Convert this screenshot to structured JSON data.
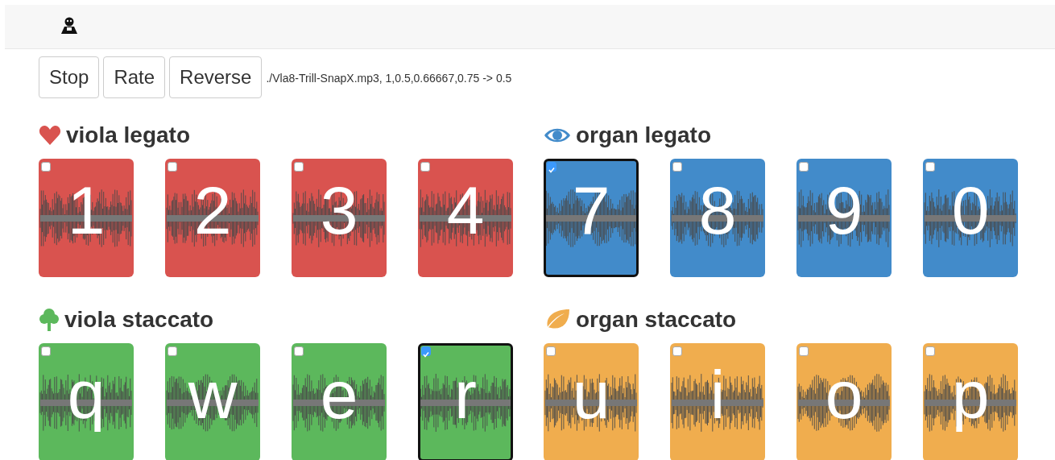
{
  "toolbar": {
    "buttons": [
      "Stop",
      "Rate",
      "Reverse"
    ],
    "status": "./Vla8-Trill-SnapX.mp3, 1,0.5,0.66667,0.75 -> 0.5"
  },
  "sections": [
    {
      "title": "viola legato",
      "color": "#d9534f",
      "cards": [
        {
          "key": "1",
          "selected": false
        },
        {
          "key": "2",
          "selected": false
        },
        {
          "key": "3",
          "selected": false
        },
        {
          "key": "4",
          "selected": false
        }
      ]
    },
    {
      "title": "organ legato",
      "color": "#428bca",
      "cards": [
        {
          "key": "7",
          "selected": true
        },
        {
          "key": "8",
          "selected": false
        },
        {
          "key": "9",
          "selected": false
        },
        {
          "key": "0",
          "selected": false
        }
      ]
    },
    {
      "title": "viola staccato",
      "color": "#5cb85c",
      "cards": [
        {
          "key": "q",
          "selected": false
        },
        {
          "key": "w",
          "selected": false
        },
        {
          "key": "e",
          "selected": false
        },
        {
          "key": "r",
          "selected": true
        }
      ]
    },
    {
      "title": "organ staccato",
      "color": "#f0ad4e",
      "cards": [
        {
          "key": "u",
          "selected": false
        },
        {
          "key": "i",
          "selected": false
        },
        {
          "key": "o",
          "selected": false
        },
        {
          "key": "p",
          "selected": false
        }
      ]
    }
  ]
}
